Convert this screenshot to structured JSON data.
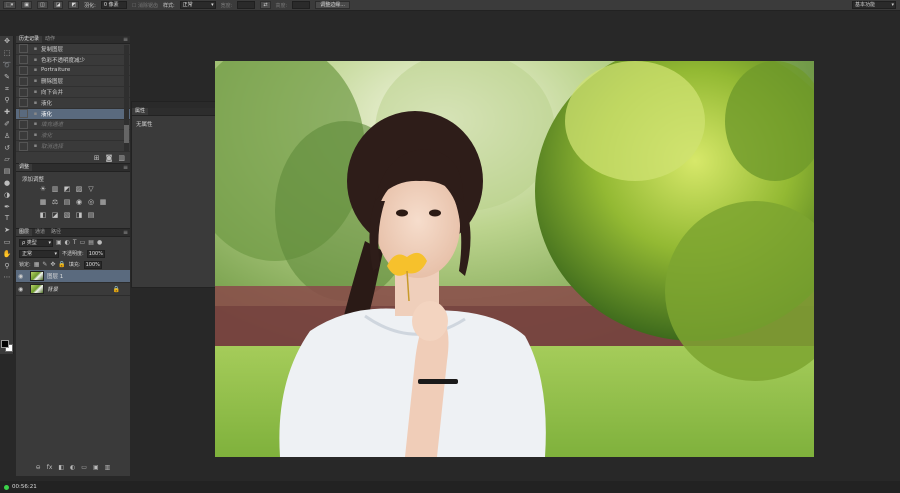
{
  "options_bar": {
    "feather_label": "羽化:",
    "feather_value": "0 像素",
    "antialias_label": "消除锯齿",
    "style_label": "样式:",
    "style_value": "正常",
    "width_label": "宽度:",
    "height_label": "高度:",
    "refine_edge": "调整边缘...",
    "workspace": "基本功能"
  },
  "history": {
    "tabs": [
      "历史记录",
      "动作"
    ],
    "items": [
      {
        "label": "复制图层",
        "state": "normal"
      },
      {
        "label": "色彩不透明度减少",
        "state": "normal"
      },
      {
        "label": "Portraiture",
        "state": "normal"
      },
      {
        "label": "删除图层",
        "state": "normal"
      },
      {
        "label": "向下合并",
        "state": "normal"
      },
      {
        "label": "液化",
        "state": "normal"
      },
      {
        "label": "液化",
        "state": "selected"
      },
      {
        "label": "填充通道",
        "state": "dimmed"
      },
      {
        "label": "液化",
        "state": "dimmed"
      },
      {
        "label": "取消选择",
        "state": "dimmed"
      }
    ]
  },
  "adjustments": {
    "tab": "调整",
    "title": "添加调整",
    "row1": [
      "☀",
      "▥",
      "◩",
      "▨",
      "▽"
    ],
    "row2": [
      "▦",
      "⚖",
      "▤",
      "◉",
      "◎",
      "▦"
    ],
    "row3": [
      "◧",
      "◪",
      "▧",
      "◨",
      "▤"
    ]
  },
  "layers": {
    "tabs": [
      "图层",
      "通道",
      "路径"
    ],
    "kind": "ρ 类型",
    "blend_mode": "正常",
    "opacity_label": "不透明度:",
    "opacity_value": "100%",
    "lock_label": "锁定:",
    "fill_label": "填充:",
    "fill_value": "100%",
    "items": [
      {
        "name": "图层 1",
        "active": true,
        "locked": false
      },
      {
        "name": "背景",
        "active": false,
        "locked": true
      }
    ],
    "footer_icons": [
      "⊖",
      "fx",
      "◧",
      "◐",
      "▭",
      "▣",
      "🗑"
    ]
  },
  "properties": {
    "tab": "属性",
    "body": "无属性"
  },
  "status": {
    "time": "00:56:21"
  },
  "colors": {
    "accent_selection": "#5a6a7e",
    "status_green": "#3bd24a"
  }
}
